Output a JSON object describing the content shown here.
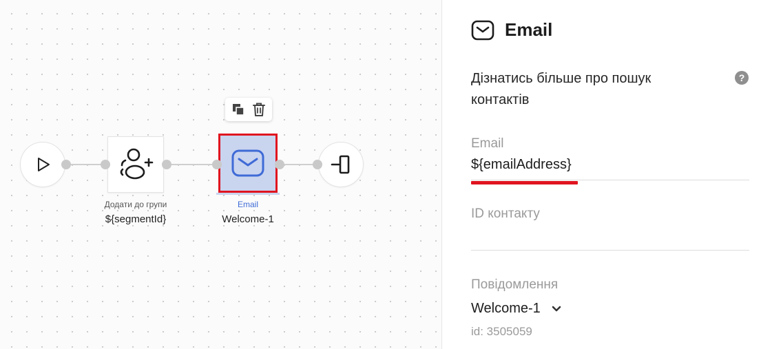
{
  "canvas": {
    "nodes": {
      "start": {
        "icon": "play-icon"
      },
      "add_to_group": {
        "icon": "add-user-group-icon",
        "type_label": "Додати до групи",
        "value": "${segmentId}"
      },
      "email": {
        "icon": "envelope-icon",
        "type_label": "Email",
        "value": "Welcome-1"
      },
      "exit": {
        "icon": "exit-icon"
      }
    },
    "toolbar": {
      "copy_icon": "copy-icon",
      "delete_icon": "trash-icon"
    },
    "colors": {
      "selected_fill": "#c9d4ef",
      "highlight": "#e0141f",
      "email_icon": "#3f6bd6",
      "email_label": "#3f6bd6"
    }
  },
  "panel": {
    "title": "Email",
    "title_icon": "envelope-icon",
    "help_text": "Дізнатись більше про пошук контактів",
    "help_icon": "question-icon",
    "fields": {
      "email": {
        "label": "Email",
        "value": "${emailAddress}"
      },
      "contact_id": {
        "label": "ID контакту",
        "value": ""
      },
      "message": {
        "label": "Повідомлення",
        "value": "Welcome-1",
        "id_text": "id: 3505059"
      }
    }
  }
}
